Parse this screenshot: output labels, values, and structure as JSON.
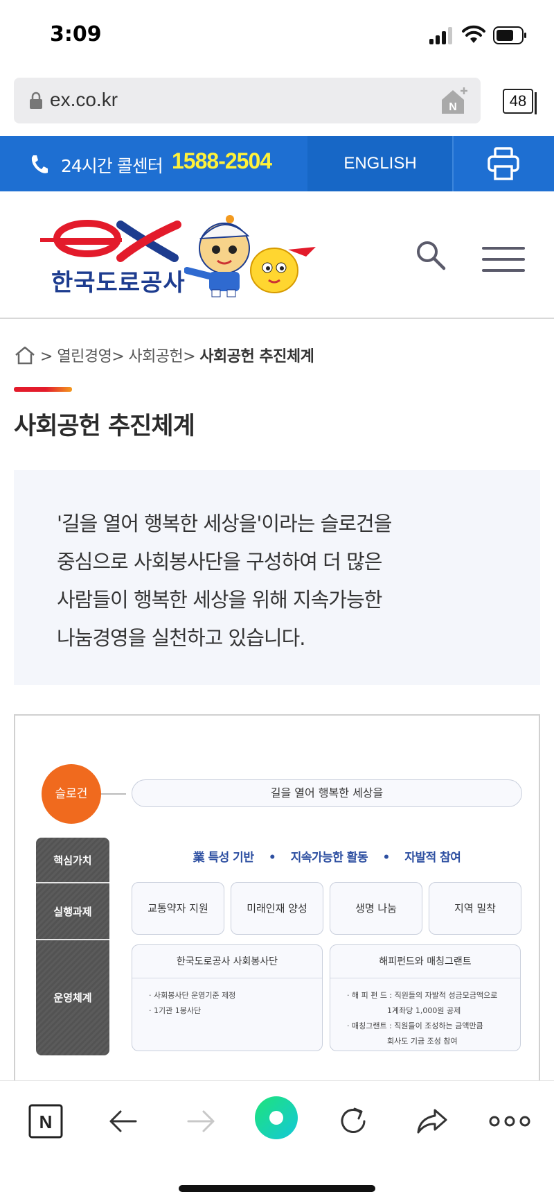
{
  "status_bar": {
    "time": "3:09"
  },
  "browser": {
    "url": "ex.co.kr",
    "tab_count": "48"
  },
  "top_bar": {
    "call_label": "24시간 콜센터",
    "call_number": "1588-2504",
    "english_label": "ENGLISH",
    "colors": {
      "bar": "#1e6fd2",
      "number": "#fff23a"
    }
  },
  "header": {
    "logo_text": "한국도로공사",
    "logo_mark": "ex"
  },
  "breadcrumb": [
    "> 열린경영>",
    "사회공헌>",
    "사회공헌 추진체계"
  ],
  "page_title": "사회공헌 추진체계",
  "intro": {
    "lines": [
      "'길을 열어 행복한 세상을'이라는 슬로건을",
      "중심으로 사회봉사단을 구성하여 더 많은",
      "사람들이 행복한 세상을 위해 지속가능한",
      "나눔경영을 실천하고 있습니다."
    ]
  },
  "diagram": {
    "slogan_label": "슬로건",
    "slogan": "길을 열어 행복한 세상을",
    "row_labels": [
      "핵심가치",
      "실행과제",
      "운영체계"
    ],
    "core_values": [
      "業 특성 기반",
      "지속가능한 활동",
      "자발적 참여"
    ],
    "core_value_separator": "•",
    "tasks": [
      "교통약자 지원",
      "미래인재 양성",
      "생명 나눔",
      "지역 밀착"
    ],
    "operations": [
      {
        "title": "한국도로공사 사회봉사단",
        "items": [
          "· 사회봉사단 운영기준 제정",
          "· 1기관 1봉사단"
        ]
      },
      {
        "title": "해피펀드와 매칭그랜트",
        "items": [
          "· 해 피 펀 드 : 직원들의 자발적 성금모금액으로",
          "1계좌당 1,000원 공제",
          "· 매칭그랜트 : 직원들이 조성하는 금액만큼",
          "회사도 기금 조성 참여"
        ]
      }
    ],
    "colors": {
      "slogan": "#f06a1e",
      "core_values": "#2d4fa1",
      "labels": "#555555"
    }
  },
  "toolbar": {
    "icons": [
      "naver-icon",
      "back-arrow-icon",
      "forward-arrow-icon",
      "green-dot-icon",
      "reload-icon",
      "share-icon",
      "more-icon"
    ]
  }
}
